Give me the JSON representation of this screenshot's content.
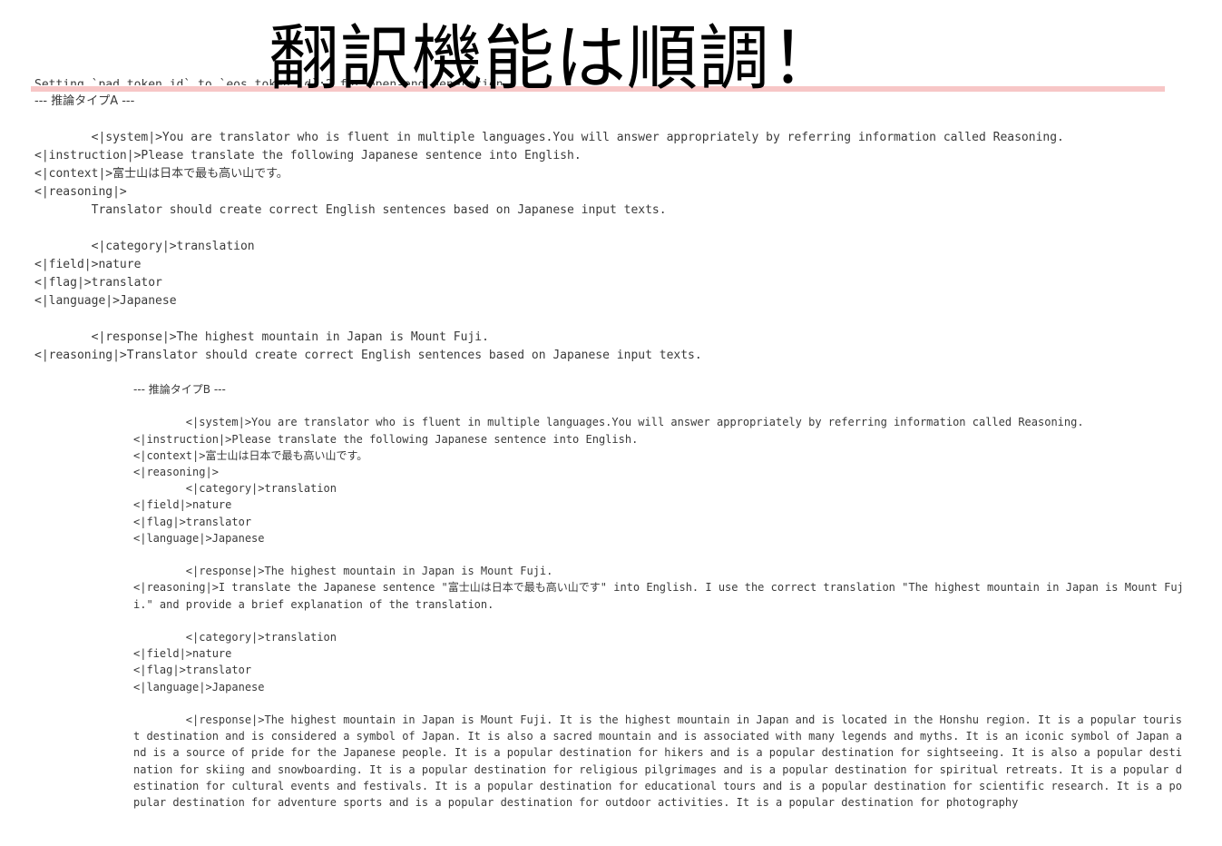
{
  "headline": "翻訳機能は順調！",
  "cutoff_line": "Setting `pad_token_id` to `eos_token_id`:2 for open-end generation.",
  "type_a": {
    "header": "--- 推論タイプA ---",
    "system": "\t<|system|>You are translator who is fluent in multiple languages.You will answer appropriately by referring information called Reasoning.",
    "instruction": "<|instruction|>Please translate the following Japanese sentence into English.",
    "context": "<|context|>富士山は日本で最も高い山です。",
    "reasoning_tag": "<|reasoning|>",
    "reasoning_text": "\tTranslator should create correct English sentences based on Japanese input texts.",
    "category": "\t<|category|>translation",
    "field": "<|field|>nature",
    "flag": "<|flag|>translator",
    "language": "<|language|>Japanese",
    "response": "\t<|response|>The highest mountain in Japan is Mount Fuji.",
    "reasoning_out": "<|reasoning|>Translator should create correct English sentences based on Japanese input texts."
  },
  "type_b": {
    "header": "--- 推論タイプB ---",
    "system": "\t<|system|>You are translator who is fluent in multiple languages.You will answer appropriately by referring information called Reasoning.",
    "instruction": "<|instruction|>Please translate the following Japanese sentence into English.",
    "context": "<|context|>富士山は日本で最も高い山です。",
    "reasoning_tag": "<|reasoning|>",
    "category": "\t<|category|>translation",
    "field": "<|field|>nature",
    "flag": "<|flag|>translator",
    "language": "<|language|>Japanese",
    "response": "\t<|response|>The highest mountain in Japan is Mount Fuji.",
    "reasoning_out": "<|reasoning|>I translate the Japanese sentence \"富士山は日本で最も高い山です\" into English. I use the correct translation \"The highest mountain in Japan is Mount Fuji.\" and provide a brief explanation of the translation.",
    "category2": "\t<|category|>translation",
    "field2": "<|field|>nature",
    "flag2": "<|flag|>translator",
    "language2": "<|language|>Japanese",
    "response2": "\t<|response|>The highest mountain in Japan is Mount Fuji. It is the highest mountain in Japan and is located in the Honshu region. It is a popular tourist destination and is considered a symbol of Japan. It is also a sacred mountain and is associated with many legends and myths. It is an iconic symbol of Japan and is a source of pride for the Japanese people. It is a popular destination for hikers and is a popular destination for sightseeing. It is also a popular destination for skiing and snowboarding. It is a popular destination for religious pilgrimages and is a popular destination for spiritual retreats. It is a popular destination for cultural events and festivals. It is a popular destination for educational tours and is a popular destination for scientific research. It is a popular destination for adventure sports and is a popular destination for outdoor activities. It is a popular destination for photography"
  }
}
